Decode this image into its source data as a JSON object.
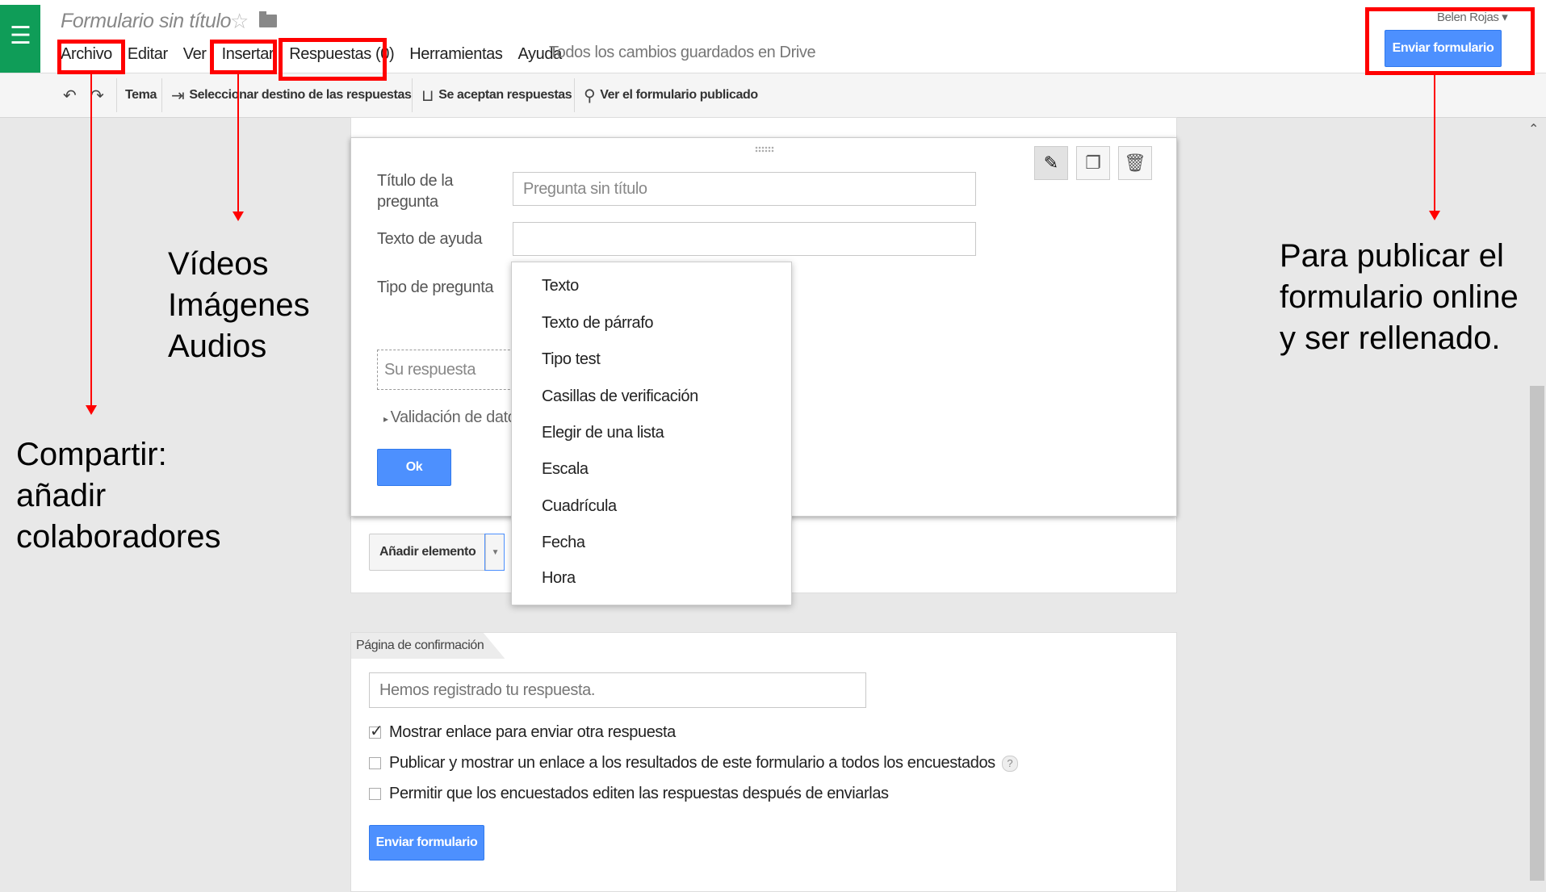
{
  "app": {
    "doc_title": "Formulario sin título",
    "user_name": "Belen Rojas ▾",
    "save_status": "Todos los cambios guardados en Drive",
    "send_button": "Enviar formulario"
  },
  "menus": [
    "Archivo",
    "Editar",
    "Ver",
    "Insertar",
    "Respuestas (0)",
    "Herramientas",
    "Ayuda"
  ],
  "toolbar": {
    "undo_icon": "undo-icon",
    "redo_icon": "redo-icon",
    "theme": "Tema",
    "destination": "Seleccionar destino de las respuestas",
    "accepting": "Se aceptan respuestas",
    "view_published": "Ver el formulario publicado"
  },
  "question": {
    "title_label": "Título de la pregunta",
    "title_placeholder": "Pregunta sin título",
    "help_label": "Texto de ayuda",
    "help_value": "",
    "type_label": "Tipo de pregunta",
    "answer_preview": "Su respuesta",
    "validation": "Validación de datos",
    "ok_button": "Ok"
  },
  "add_element": "Añadir elemento",
  "type_menu": [
    "Texto",
    "Texto de párrafo",
    "Tipo test",
    "Casillas de verificación",
    "Elegir de una lista",
    "Escala",
    "Cuadrícula",
    "Fecha",
    "Hora"
  ],
  "confirmation": {
    "tab": "Página de confirmación",
    "message": "Hemos registrado tu respuesta.",
    "options": [
      {
        "label": "Mostrar enlace para enviar otra respuesta",
        "checked": true
      },
      {
        "label": "Publicar y mostrar un enlace a los resultados de este formulario a todos los encuestados",
        "checked": false,
        "help": "?"
      },
      {
        "label": "Permitir que los encuestados editen las respuestas después de enviarlas",
        "checked": false
      }
    ],
    "send_button": "Enviar formulario"
  },
  "annotations": {
    "insert_note": "Vídeos\nImágenes\nAudios",
    "share_note": "Compartir:\nañadir\ncolaboradores",
    "publish_note": "Para publicar el\nformulario online\ny ser rellenado.",
    "highlight_color": "#ff0000"
  }
}
